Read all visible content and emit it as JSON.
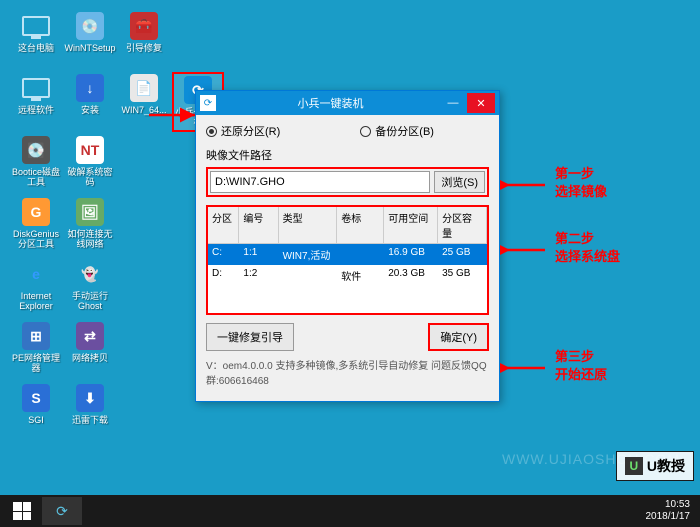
{
  "desktop": {
    "rows": [
      [
        {
          "name": "this-pc",
          "label": "这台电脑",
          "bg": "",
          "glyph": "monitor"
        },
        {
          "name": "winntsetup",
          "label": "WinNTSetup",
          "bg": "#6ab7e8",
          "glyph": "💿"
        },
        {
          "name": "boot-repair",
          "label": "引导修复",
          "bg": "#c73030",
          "glyph": "🧰"
        }
      ],
      [
        {
          "name": "remote-soft",
          "label": "远程软件",
          "bg": "",
          "glyph": "monitor"
        },
        {
          "name": "install",
          "label": "安装",
          "bg": "#2a6fd6",
          "glyph": "↓"
        },
        {
          "name": "win7-64",
          "label": "WIN7_64...",
          "bg": "#e8e8e8",
          "glyph": "📄"
        },
        {
          "name": "xiaobing-installer",
          "label": "小兵一键装机",
          "bg": "#0d8dd7",
          "glyph": "⟳",
          "selected": true
        }
      ],
      [
        {
          "name": "bootice-disk",
          "label": "Bootice磁盘工具",
          "bg": "#555",
          "glyph": "💽"
        },
        {
          "name": "crack-pwd",
          "label": "破解系统密码",
          "bg": "#fff",
          "glyph": "NT",
          "textcolor": "#c73030"
        }
      ],
      [
        {
          "name": "diskgenius",
          "label": "DiskGenius分区工具",
          "bg": "#ff9933",
          "glyph": "G"
        },
        {
          "name": "wifi-connect",
          "label": "如何连接无线网络",
          "bg": "#66aa66",
          "glyph": "🖼"
        }
      ],
      [
        {
          "name": "ie",
          "label": "Internet Explorer",
          "bg": "",
          "glyph": "e",
          "textcolor": "#3399ff"
        },
        {
          "name": "manual-ghost",
          "label": "手动运行Ghost",
          "bg": "",
          "glyph": "👻"
        }
      ],
      [
        {
          "name": "pe-net-mgr",
          "label": "PE网络管理器",
          "bg": "#3474c4",
          "glyph": "⊞"
        },
        {
          "name": "net-clone",
          "label": "网络拷贝",
          "bg": "#6b4fa0",
          "glyph": "⇄"
        }
      ],
      [
        {
          "name": "sgi",
          "label": "SGI",
          "bg": "#2a6fd6",
          "glyph": "S"
        },
        {
          "name": "xunlei",
          "label": "迅雷下载",
          "bg": "#2a6fd6",
          "glyph": "⬇"
        }
      ]
    ]
  },
  "window": {
    "title": "小兵一键装机",
    "restore_radio": "还原分区(R)",
    "backup_radio": "备份分区(B)",
    "path_label": "映像文件路径",
    "path_value": "D:\\WIN7.GHO",
    "browse": "浏览(S)",
    "columns": {
      "c1": "分区",
      "c2": "编号",
      "c3": "类型",
      "c4": "卷标",
      "c5": "可用空间",
      "c6": "分区容量"
    },
    "rows": [
      {
        "c1": "C:",
        "c2": "1:1",
        "c3": "WIN7,活动",
        "c4": "",
        "c5": "16.9 GB",
        "c6": "25 GB",
        "selected": true
      },
      {
        "c1": "D:",
        "c2": "1:2",
        "c3": "",
        "c4": "软件",
        "c5": "20.3 GB",
        "c6": "35 GB",
        "selected": false
      }
    ],
    "repair_btn": "一键修复引导",
    "confirm_btn": "确定(Y)",
    "status": "V：oem4.0.0.0       支持多种镜像,多系统引导自动修复 问题反馈QQ群:606616468"
  },
  "annotations": {
    "step1_title": "第一步",
    "step1_sub": "选择镜像",
    "step2_title": "第二步",
    "step2_sub": "选择系统盘",
    "step3_title": "第三步",
    "step3_sub": "开始还原"
  },
  "watermark": "WWW.UJIAOSHOU.COM",
  "logo": "U教授",
  "tray": {
    "time": "10:53",
    "date": "2018/1/17"
  }
}
